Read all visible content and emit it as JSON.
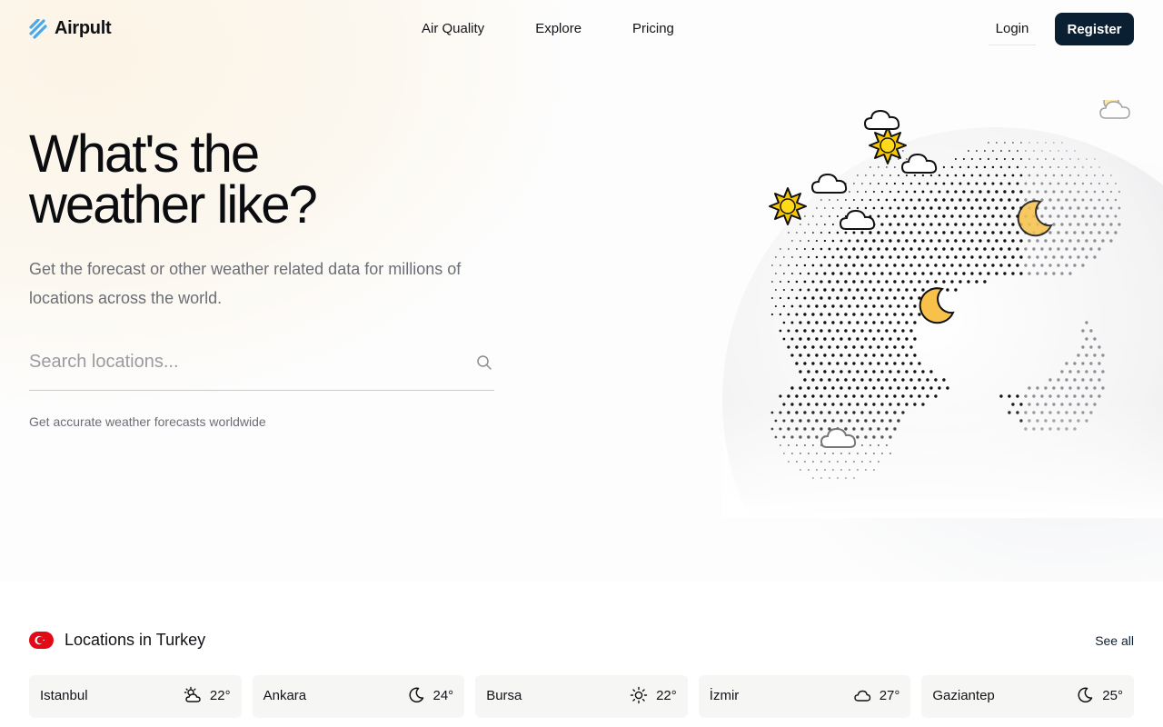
{
  "header": {
    "logo": "Airpult",
    "nav": [
      "Air Quality",
      "Explore",
      "Pricing"
    ],
    "login": "Login",
    "register": "Register"
  },
  "hero": {
    "title": "What's the\nweather like?",
    "subtitle": "Get the forecast or other weather related data for millions of locations across the world.",
    "search_placeholder": "Search locations...",
    "note": "Get accurate weather forecasts worldwide"
  },
  "locations": {
    "title": "Locations in Turkey",
    "see_all": "See all",
    "flag_icon": "turkey-flag-icon",
    "cards": [
      {
        "city": "Istanbul",
        "temp": "22°",
        "icon": "partly-cloudy-icon"
      },
      {
        "city": "Ankara",
        "temp": "24°",
        "icon": "moon-icon"
      },
      {
        "city": "Bursa",
        "temp": "22°",
        "icon": "sun-icon"
      },
      {
        "city": "İzmir",
        "temp": "27°",
        "icon": "cloud-icon"
      },
      {
        "city": "Gaziantep",
        "temp": "25°",
        "icon": "moon-icon"
      }
    ]
  },
  "colors": {
    "brand_dark": "#0b1f33",
    "logo_accent": "#4aa8e8",
    "flag_red": "#e30a17"
  }
}
